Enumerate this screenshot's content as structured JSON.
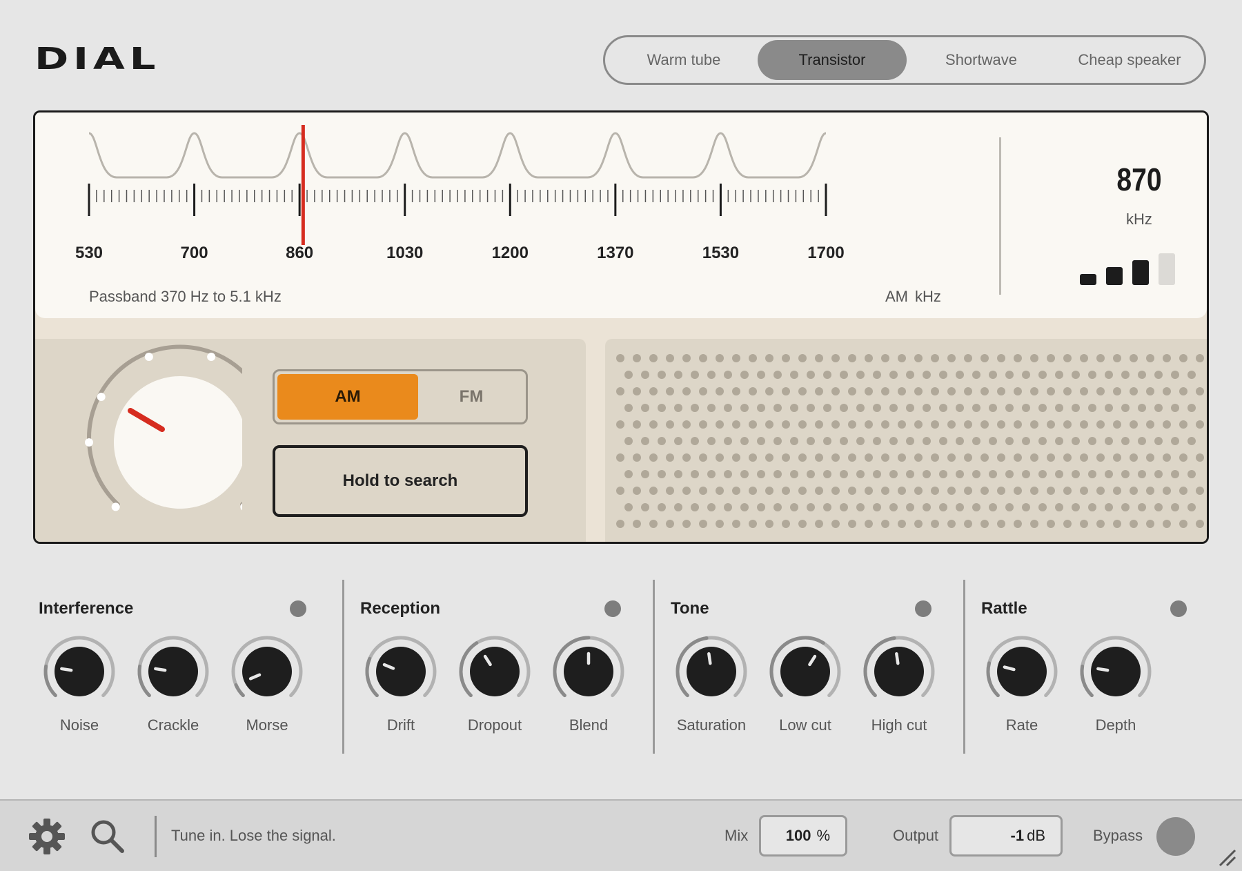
{
  "app": {
    "logo": "DIAL"
  },
  "presets": [
    {
      "label": "Warm tube",
      "active": false
    },
    {
      "label": "Transistor",
      "active": true
    },
    {
      "label": "Shortwave",
      "active": false
    },
    {
      "label": "Cheap speaker",
      "active": false
    }
  ],
  "dial": {
    "scale_labels": [
      "530",
      "700",
      "860",
      "1030",
      "1200",
      "1370",
      "1530",
      "1700"
    ],
    "scale_min": 530,
    "scale_max": 1700,
    "needle_value": 870,
    "needle_color": "#d62c1f",
    "passband": "Passband 370 Hz to 5.1 kHz",
    "band": "AM",
    "unit": "kHz"
  },
  "readout": {
    "frequency": "870",
    "unit": "kHz",
    "signal_level": 3,
    "signal_max": 5
  },
  "band_switch": {
    "options": [
      "AM",
      "FM"
    ],
    "selected": "AM",
    "accent": "#ea8a1c"
  },
  "search_button": {
    "label": "Hold to search"
  },
  "sections": [
    {
      "title": "Interference",
      "knobs": [
        {
          "label": "Noise",
          "value": 0.2
        },
        {
          "label": "Crackle",
          "value": 0.2
        },
        {
          "label": "Morse",
          "value": 0.08
        }
      ]
    },
    {
      "title": "Reception",
      "knobs": [
        {
          "label": "Drift",
          "value": 0.25
        },
        {
          "label": "Dropout",
          "value": 0.38
        },
        {
          "label": "Blend",
          "value": 0.5
        }
      ]
    },
    {
      "title": "Tone",
      "knobs": [
        {
          "label": "Saturation",
          "value": 0.47
        },
        {
          "label": "Low cut",
          "value": 0.62
        },
        {
          "label": "High cut",
          "value": 0.47
        }
      ]
    },
    {
      "title": "Rattle",
      "knobs": [
        {
          "label": "Rate",
          "value": 0.22
        },
        {
          "label": "Depth",
          "value": 0.2
        }
      ]
    }
  ],
  "footer": {
    "status": "Tune in. Lose the signal.",
    "mix_label": "Mix",
    "mix_value": "100",
    "mix_unit": "%",
    "output_label": "Output",
    "output_value": "-1",
    "output_unit": "dB",
    "bypass_label": "Bypass"
  }
}
